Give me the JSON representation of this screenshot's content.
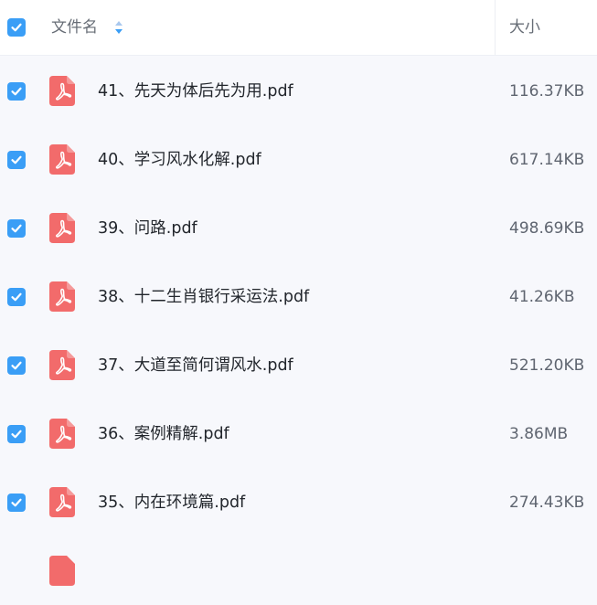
{
  "header": {
    "name_label": "文件名",
    "size_label": "大小"
  },
  "colors": {
    "accent": "#3a9ef6",
    "pdf_icon": "#f26b6b",
    "background": "#f7f8fc"
  },
  "icons": {
    "checkbox": "check-icon",
    "sort": "sort-icon",
    "file": "pdf-file-icon"
  },
  "files": [
    {
      "name": "41、先天为体后先为用.pdf",
      "size": "116.37KB",
      "checked": true
    },
    {
      "name": "40、学习风水化解.pdf",
      "size": "617.14KB",
      "checked": true
    },
    {
      "name": "39、问路.pdf",
      "size": "498.69KB",
      "checked": true
    },
    {
      "name": "38、十二生肖银行采运法.pdf",
      "size": "41.26KB",
      "checked": true
    },
    {
      "name": "37、大道至简何谓风水.pdf",
      "size": "521.20KB",
      "checked": true
    },
    {
      "name": "36、案例精解.pdf",
      "size": "3.86MB",
      "checked": true
    },
    {
      "name": "35、内在环境篇.pdf",
      "size": "274.43KB",
      "checked": true
    }
  ]
}
